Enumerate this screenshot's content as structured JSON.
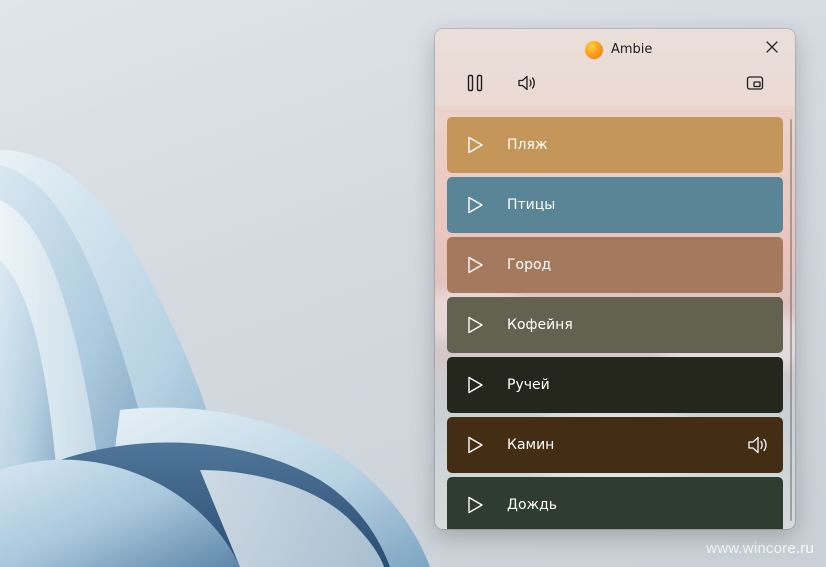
{
  "watermark": "www.wincore.ru",
  "window": {
    "title": "Ambie",
    "logo_icon": "ambie-logo-icon",
    "close_icon": "close-icon"
  },
  "toolbar": {
    "pause_icon": "pause-icon",
    "volume_icon": "volume-icon",
    "compact_icon": "compact-overlay-icon"
  },
  "sounds": [
    {
      "label": "Пляж",
      "color": "#c4965a",
      "playing": false
    },
    {
      "label": "Птицы",
      "color": "#5a8596",
      "playing": false
    },
    {
      "label": "Город",
      "color": "#a5795d",
      "playing": false
    },
    {
      "label": "Кофейня",
      "color": "#636150",
      "playing": false
    },
    {
      "label": "Ручей",
      "color": "#25271d",
      "playing": false
    },
    {
      "label": "Камин",
      "color": "#432d14",
      "playing": true
    },
    {
      "label": "Дождь",
      "color": "#2f3d30",
      "playing": false
    }
  ],
  "colors": {
    "accent_logo": "#ff9a1f",
    "card_text": "#ffffff"
  }
}
